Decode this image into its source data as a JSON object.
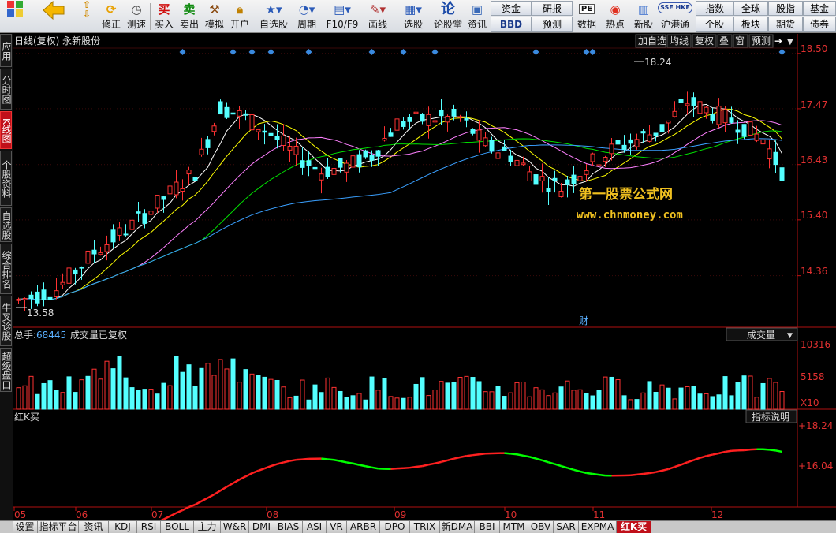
{
  "toolbar": {
    "items": [
      {
        "id": "fullscreen",
        "label": "",
        "icon": "grid-icon"
      },
      {
        "id": "back",
        "label": "",
        "icon": "back-arrow-icon"
      },
      {
        "id": "fix",
        "label": "修正",
        "icon": "updown-arrow-icon"
      },
      {
        "id": "refresh",
        "label": "修正",
        "icon": "refresh-icon"
      },
      {
        "id": "clock",
        "label": "测速",
        "icon": "clock-icon"
      },
      {
        "id": "buy",
        "label": "买入",
        "icon": "买"
      },
      {
        "id": "sell",
        "label": "卖出",
        "icon": "卖"
      },
      {
        "id": "sim",
        "label": "模拟",
        "icon": "hammer-icon"
      },
      {
        "id": "open",
        "label": "开户",
        "icon": "lock-icon"
      },
      {
        "id": "watch",
        "label": "自选股",
        "icon": "star-icon"
      },
      {
        "id": "period",
        "label": "周期",
        "icon": "period-icon"
      },
      {
        "id": "f10",
        "label": "F10/F9",
        "icon": "f10-icon"
      },
      {
        "id": "draw",
        "label": "画线",
        "icon": "pencil-icon"
      },
      {
        "id": "select",
        "label": "选股",
        "icon": "select-icon"
      },
      {
        "id": "forum",
        "label": "论股堂",
        "icon": "forum-icon"
      },
      {
        "id": "info",
        "label": "资讯",
        "icon": "doc-icon"
      }
    ],
    "grid_left": [
      [
        "资金",
        "研报"
      ],
      [
        "BBD",
        "预测"
      ]
    ],
    "mid_items": [
      {
        "id": "data",
        "label": "数据",
        "icon": "PE"
      },
      {
        "id": "hot",
        "label": "热点",
        "icon": "hot-icon"
      },
      {
        "id": "ipo",
        "label": "新股",
        "icon": "ipo-icon"
      },
      {
        "id": "hk",
        "label": "沪港通",
        "icon": "SSE HKE"
      }
    ],
    "grid_right": [
      [
        "指数",
        "全球",
        "股指",
        "基金"
      ],
      [
        "个股",
        "板块",
        "期货",
        "债券"
      ]
    ]
  },
  "sidebar": {
    "tabs": [
      "应用",
      "分时图",
      "K线图",
      "个股资料",
      "自选股",
      "综合排名",
      "牛叉诊股",
      "超级盘口"
    ],
    "active": "K线图"
  },
  "chart_header": {
    "title": "日线(复权) 永新股份",
    "buttons": [
      "加自选",
      "均线",
      "复权",
      "叠",
      "窗",
      "预测"
    ]
  },
  "watermark": {
    "line1": "第一股票公式网",
    "line2": "www.chnmoney.com"
  },
  "marker_text": "财",
  "volume_header": {
    "total_label": "总手:",
    "total_value": "68445",
    "note": "成交量已复权",
    "dropdown": "成交量"
  },
  "indicator_header": {
    "name": "红K买",
    "button": "指标说明"
  },
  "axis": {
    "price_ticks": [
      "18.50",
      "17.47",
      "16.43",
      "15.40",
      "14.36"
    ],
    "volume_ticks": [
      "10316",
      "5158"
    ],
    "volume_unit": "X10",
    "indicator_ticks": [
      "+18.24",
      "+16.04"
    ],
    "month_labels": [
      "05",
      "06",
      "07",
      "08",
      "09",
      "10",
      "11",
      "12"
    ]
  },
  "chart_data": {
    "type": "candlestick",
    "title": "日线(复权) 永新股份",
    "ylim": [
      13.4,
      18.6
    ],
    "high_annotation": "18.24",
    "low_annotation": "13.58",
    "volume_ylim": [
      0,
      10316
    ],
    "indicator_ylim": [
      15.3,
      18.6
    ]
  },
  "colors": {
    "up": "#ff3232",
    "down": "#54ffff",
    "ma5": "#ffffff",
    "ma10": "#ffff00",
    "ma20": "#ff80ff",
    "ma30": "#00e000",
    "ma60": "#3aa0ff",
    "indicator_up": "#ff2020",
    "indicator_down": "#00ff00",
    "axis": "#c01010"
  },
  "bottom_tabs": [
    "设置",
    "指标平台",
    "资讯",
    "KDJ",
    "RSI",
    "BOLL",
    "主力",
    "W&R",
    "DMI",
    "BIAS",
    "ASI",
    "VR",
    "ARBR",
    "DPO",
    "TRIX",
    "新DMA",
    "BBI",
    "MTM",
    "OBV",
    "SAR",
    "EXPMA",
    "红K买"
  ],
  "bottom_active": "红K买"
}
